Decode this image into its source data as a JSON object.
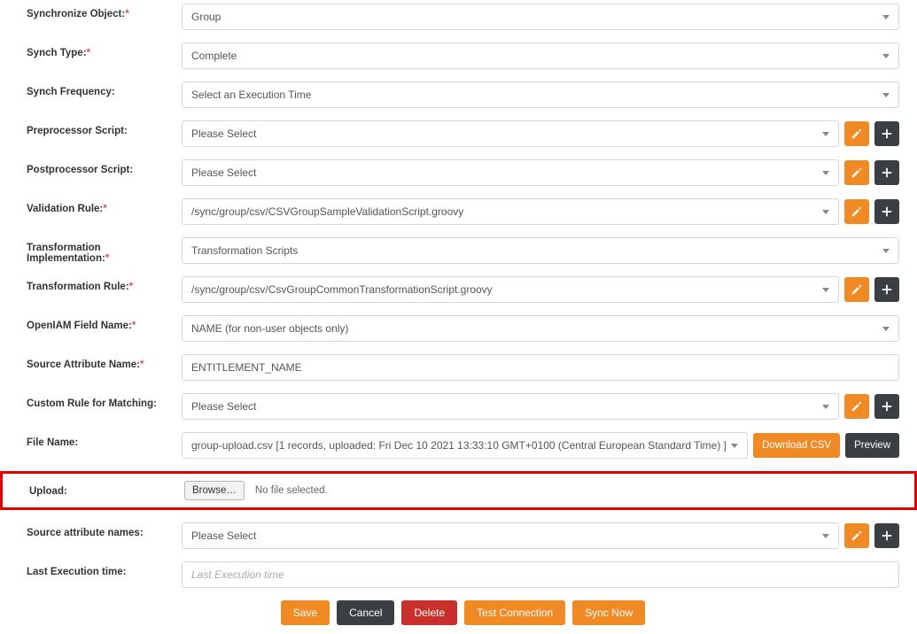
{
  "fields": {
    "sync_object": {
      "label": "Synchronize Object:",
      "required": true,
      "value": "Group"
    },
    "synch_type": {
      "label": "Synch Type:",
      "required": true,
      "value": "Complete"
    },
    "synch_freq": {
      "label": "Synch Frequency:",
      "required": false,
      "value": "Select an Execution Time"
    },
    "preproc": {
      "label": "Preprocessor Script:",
      "required": false,
      "value": "Please Select"
    },
    "postproc": {
      "label": "Postprocessor Script:",
      "required": false,
      "value": "Please Select"
    },
    "validation": {
      "label": "Validation Rule:",
      "required": true,
      "value": "/sync/group/csv/CSVGroupSampleValidationScript.groovy"
    },
    "transform_impl": {
      "label": "Transformation Implementation:",
      "required": true,
      "value": "Transformation Scripts"
    },
    "transform_rule": {
      "label": "Transformation Rule:",
      "required": true,
      "value": "/sync/group/csv/CsvGroupCommonTransformationScript.groovy"
    },
    "openiam_field": {
      "label": "OpenIAM Field Name:",
      "required": true,
      "value": "NAME (for non-user objects only)"
    },
    "source_attr": {
      "label": "Source Attribute Name:",
      "required": true,
      "value": "ENTITLEMENT_NAME"
    },
    "custom_rule": {
      "label": "Custom Rule for Matching:",
      "required": false,
      "value": "Please Select"
    },
    "file_name": {
      "label": "File Name:",
      "required": false,
      "value": "group-upload.csv [1 records, uploaded: Fri Dec 10 2021 13:33:10 GMT+0100 (Central European Standard Time) ]"
    },
    "upload": {
      "label": "Upload:",
      "browse": "Browse…",
      "nofile": "No file selected."
    },
    "source_attr_names": {
      "label": "Source attribute names:",
      "required": false,
      "value": "Please Select"
    },
    "last_exec": {
      "label": "Last Execution time:",
      "required": false,
      "placeholder": "Last Execution time"
    }
  },
  "side_actions": {
    "download_csv": "Download CSV",
    "preview": "Preview"
  },
  "footer": {
    "save": "Save",
    "cancel": "Cancel",
    "delete": "Delete",
    "test": "Test Connection",
    "sync": "Sync Now"
  }
}
